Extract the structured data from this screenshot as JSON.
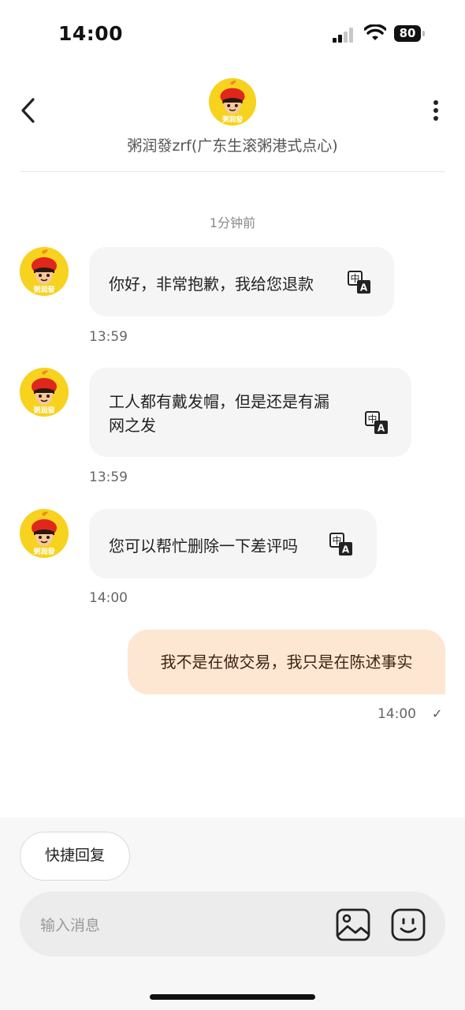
{
  "status_bar": {
    "time": "14:00",
    "battery": "80"
  },
  "header": {
    "shop_name": "粥润發zrf(广东生滚粥港式点心)"
  },
  "time_separator": "1分钟前",
  "messages": [
    {
      "from": "shop",
      "text": "你好，非常抱歉，我给您退款",
      "time": "13:59"
    },
    {
      "from": "shop",
      "text_line1": "工人都有戴发帽，但是还是有漏",
      "text_line2": "网之发",
      "time": "13:59"
    },
    {
      "from": "shop",
      "text": "您可以帮忙删除一下差评吗",
      "time": "14:00"
    },
    {
      "from": "me",
      "text": "我不是在做交易，我只是在陈述事实",
      "time": "14:00",
      "status": "✓"
    }
  ],
  "avatar": {
    "logo_text": "粥润發",
    "colors": {
      "face": "#f7d21e",
      "hat": "#e1261c",
      "hair": "#2a1a10"
    }
  },
  "translate_icon": {
    "glyph_top": "中",
    "glyph_bottom": "A"
  },
  "footer": {
    "quick_reply_label": "快捷回复",
    "input_placeholder": "输入消息"
  },
  "colors": {
    "outgoing_bubble": "#fde6d2",
    "incoming_bubble": "#f5f5f5",
    "background": "#ffffff"
  }
}
